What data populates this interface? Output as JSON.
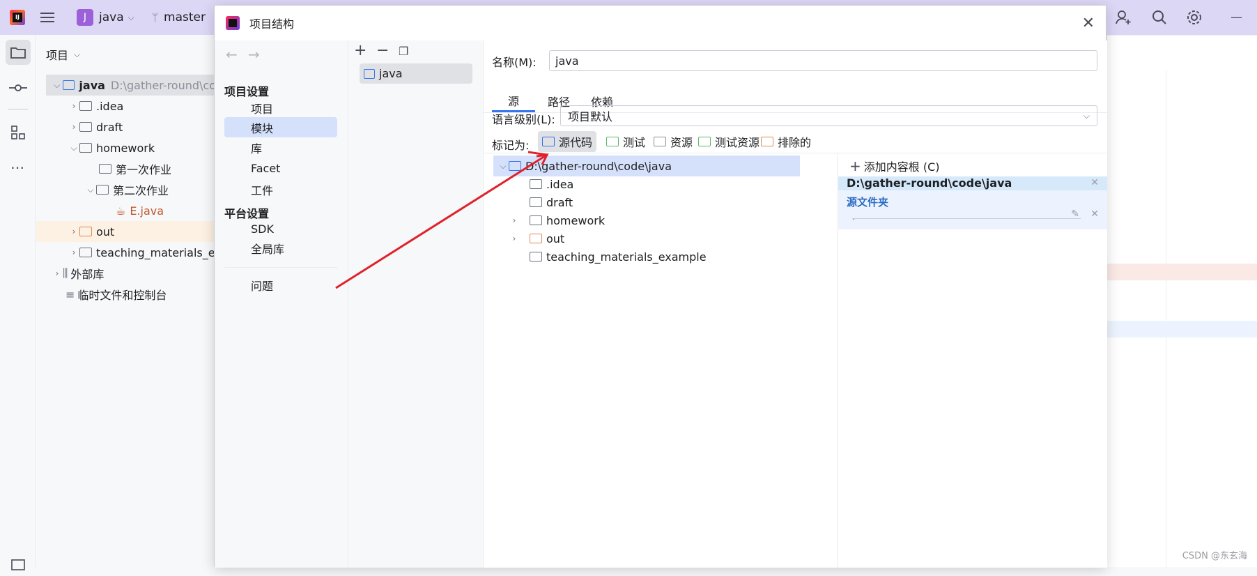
{
  "topbar": {
    "project_badge": "J",
    "project_name": "java",
    "branch": "master"
  },
  "project_panel": {
    "title": "项目",
    "tree": [
      {
        "label": "java",
        "path": "D:\\gather-round\\co"
      },
      {
        "label": ".idea"
      },
      {
        "label": "draft"
      },
      {
        "label": "homework"
      },
      {
        "label": "第一次作业"
      },
      {
        "label": "第二次作业"
      },
      {
        "label": "E.java"
      },
      {
        "label": "out"
      },
      {
        "label": "teaching_materials_ex"
      },
      {
        "label": "外部库"
      },
      {
        "label": "临时文件和控制台"
      }
    ]
  },
  "dialog": {
    "title": "项目结构",
    "nav": {
      "section1": "项目设置",
      "items1": [
        "项目",
        "模块",
        "库",
        "Facet",
        "工件"
      ],
      "section2": "平台设置",
      "items2": [
        "SDK",
        "全局库"
      ],
      "problems": "问题"
    },
    "modules": [
      "java"
    ],
    "name_label": "名称(M):",
    "name_value": "java",
    "tabs": [
      "源",
      "路径",
      "依赖"
    ],
    "lang_label": "语言级别(L):",
    "lang_value": "项目默认",
    "mark_label": "标记为:",
    "mark_buttons": [
      "源代码",
      "测试",
      "资源",
      "测试资源",
      "排除的"
    ],
    "content_tree": [
      "D:\\gather-round\\code\\java",
      ".idea",
      "draft",
      "homework",
      "out",
      "teaching_materials_example"
    ],
    "add_root": "添加内容根 (C)",
    "root_path": "D:\\gather-round\\code\\java",
    "source_folders_label": "源文件夹",
    "source_folder_entry": "."
  },
  "watermark": "CSDN @东玄海",
  "colors": {
    "accent": "#3574f0",
    "selection": "#d5e1fb",
    "topbar": "#ddd7f6",
    "arrow": "#e0222a"
  }
}
